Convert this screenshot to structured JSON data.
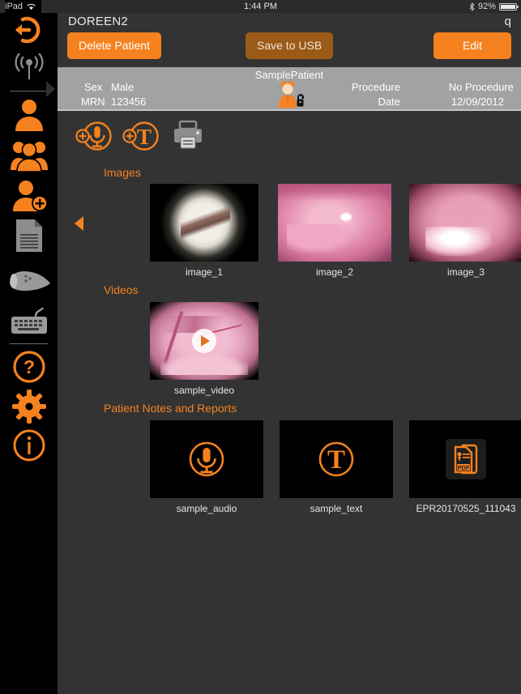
{
  "statusbar": {
    "device": "iPad",
    "wifi_icon": "wifi-icon",
    "time": "1:44 PM",
    "bluetooth_icon": "bluetooth-icon",
    "battery_pct": "92%",
    "battery_icon": "battery-icon"
  },
  "topbar": {
    "title": "DOREEN2",
    "corner_text": "q",
    "delete_label": "Delete Patient",
    "usb_label": "Save to USB",
    "edit_label": "Edit",
    "accent_color": "#f5821f",
    "disabled_color": "#9b5a18"
  },
  "patient": {
    "name": "SamplePatient",
    "avatar_icon": "patient-unlocked-icon",
    "sex_label": "Sex",
    "sex_value": "Male",
    "mrn_label": "MRN",
    "mrn_value": "123456",
    "procedure_label": "Procedure",
    "procedure_value": "No Procedure",
    "date_label": "Date",
    "date_value": "12/09/2012",
    "bar_color": "#a2a2a2"
  },
  "sidebar": {
    "items": [
      {
        "name": "back-icon",
        "state": "active"
      },
      {
        "name": "wireless-icon",
        "state": "inactive"
      },
      {
        "name": "patient-icon",
        "state": "selected"
      },
      {
        "name": "patients-group-icon",
        "state": "active"
      },
      {
        "name": "add-patient-icon",
        "state": "active"
      },
      {
        "name": "document-icon",
        "state": "inactive"
      },
      {
        "name": "camera-head-icon",
        "state": "inactive"
      },
      {
        "name": "keyboard-icon",
        "state": "inactive"
      },
      {
        "name": "help-icon",
        "state": "active"
      },
      {
        "name": "settings-gear-icon",
        "state": "active"
      },
      {
        "name": "info-icon",
        "state": "active"
      }
    ]
  },
  "actions": [
    {
      "name": "add-audio-note-button",
      "icon": "microphone-plus-icon"
    },
    {
      "name": "add-text-note-button",
      "icon": "text-plus-icon"
    },
    {
      "name": "print-button",
      "icon": "printer-icon"
    }
  ],
  "sections": {
    "images": {
      "heading": "Images",
      "prev_arrow": "previous-arrow",
      "next_arrow": "next-arrow",
      "items": [
        {
          "caption": "image_1",
          "kind": "image"
        },
        {
          "caption": "image_2",
          "kind": "image"
        },
        {
          "caption": "image_3",
          "kind": "image"
        }
      ]
    },
    "videos": {
      "heading": "Videos",
      "items": [
        {
          "caption": "sample_video",
          "kind": "video"
        }
      ]
    },
    "notes": {
      "heading": "Patient Notes and Reports",
      "items": [
        {
          "caption": "sample_audio",
          "kind": "audio"
        },
        {
          "caption": "sample_text",
          "kind": "text"
        },
        {
          "caption": "EPR20170525_111043",
          "kind": "pdf"
        }
      ]
    }
  }
}
